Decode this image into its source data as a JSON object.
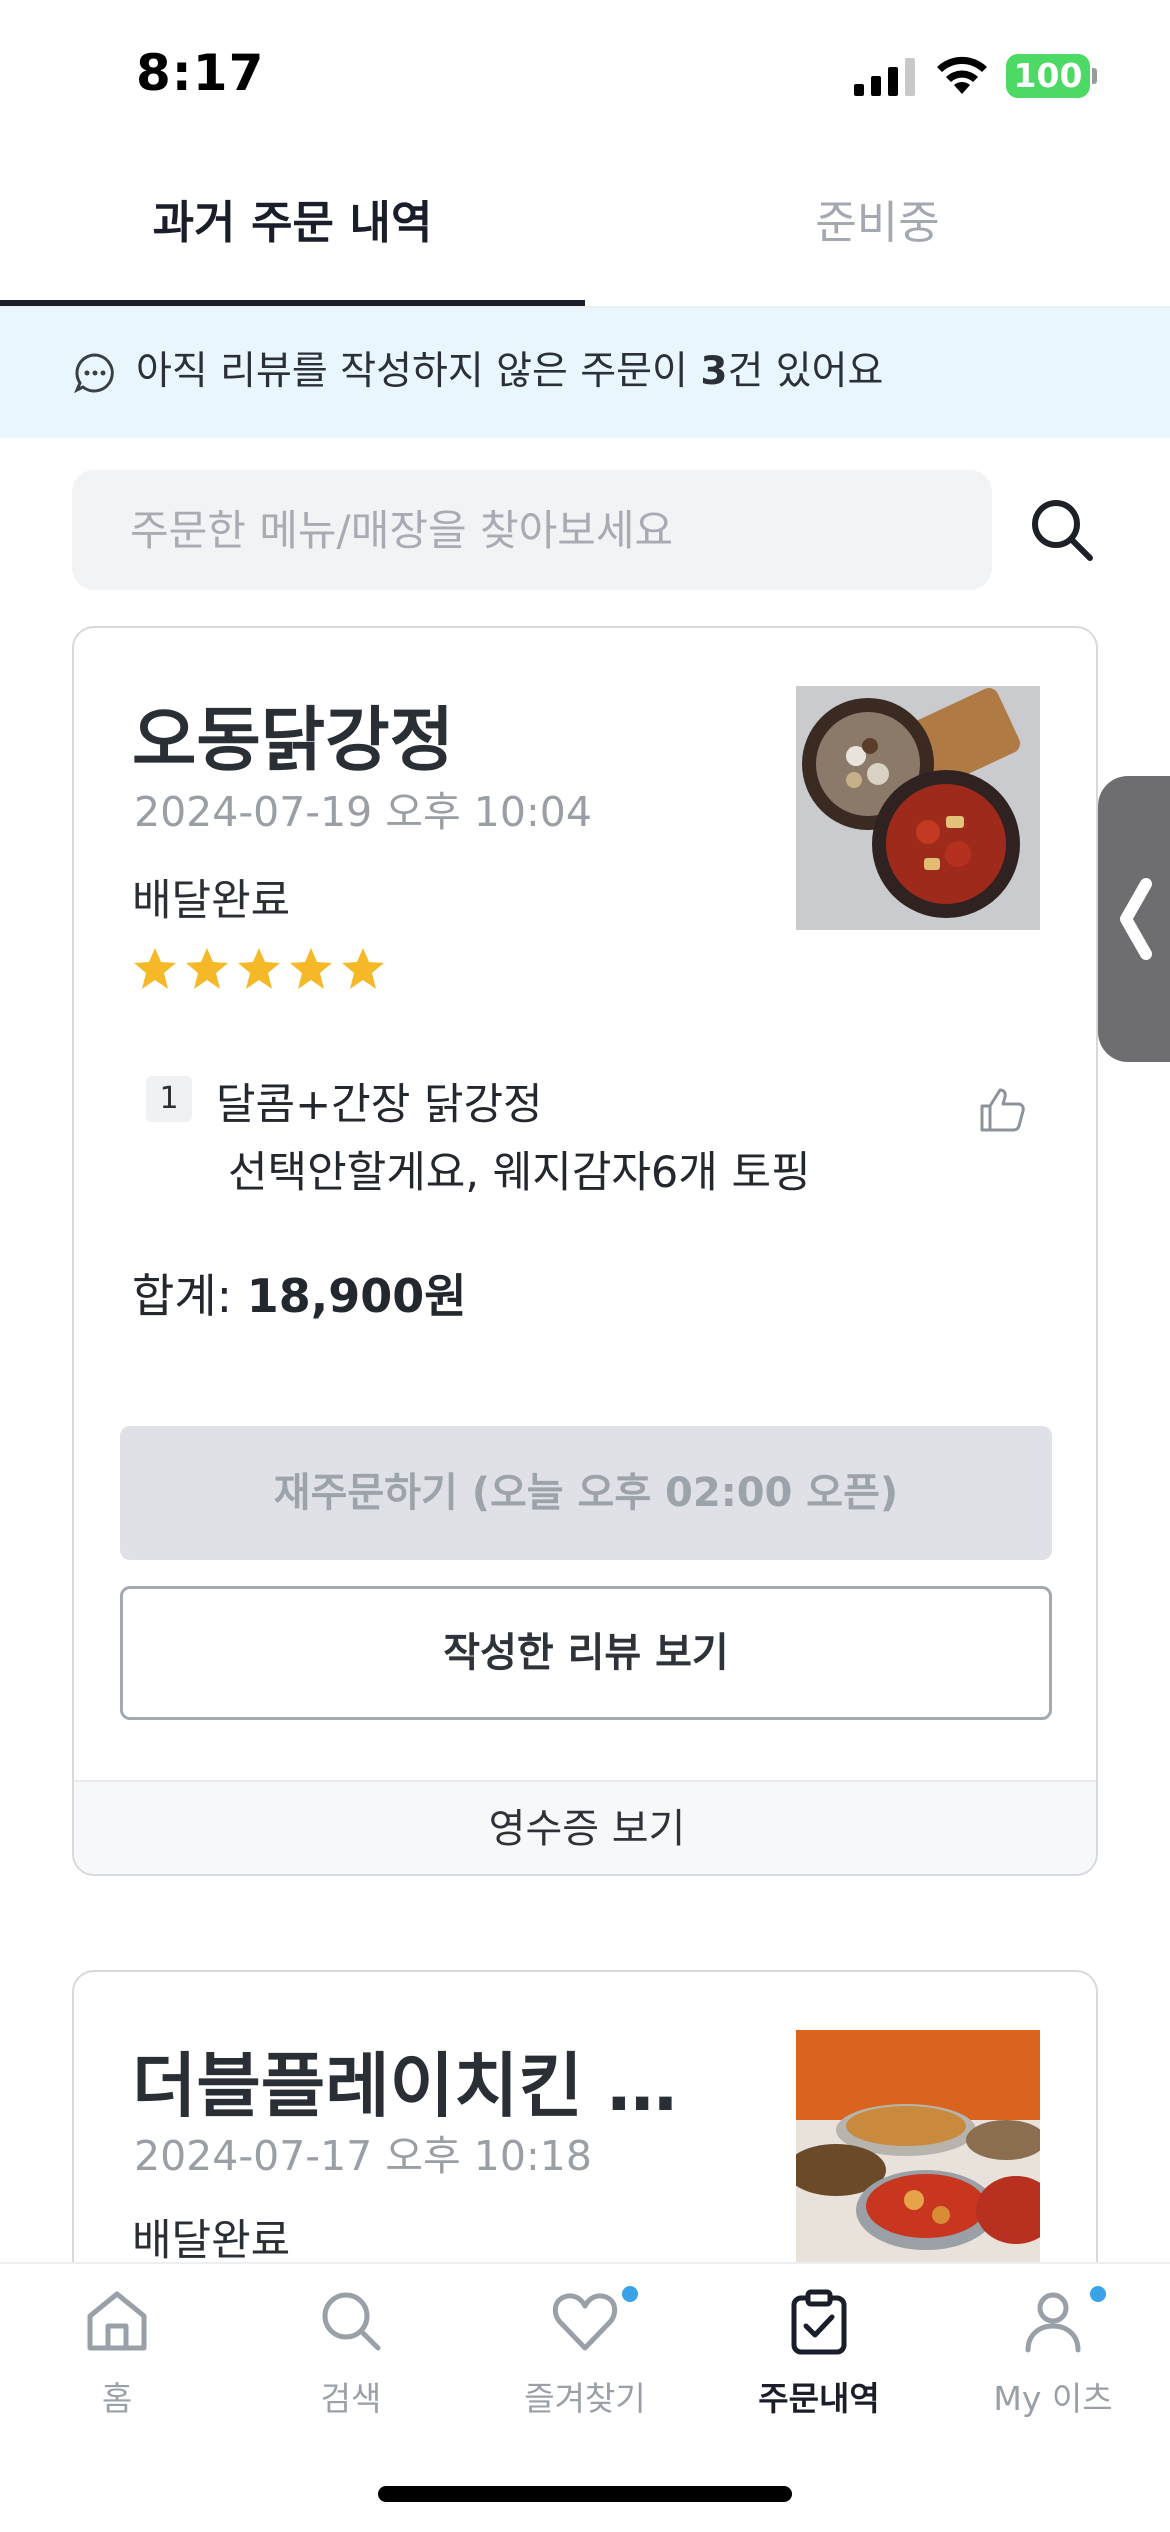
{
  "status_bar": {
    "time": "8:17",
    "battery": "100"
  },
  "tabs": [
    {
      "label": "과거 주문 내역",
      "active": true
    },
    {
      "label": "준비중",
      "active": false
    }
  ],
  "banner": {
    "text_before": "아직 리뷰를 작성하지 않은 주문이 ",
    "count": "3",
    "text_after": "건 있어요"
  },
  "search": {
    "placeholder": "주문한 메뉴/매장을 찾아보세요",
    "value": ""
  },
  "orders": [
    {
      "store": "오동닭강정",
      "date": "2024-07-19 오후 10:04",
      "status": "배달완료",
      "rating": 5,
      "items": [
        {
          "qty": "1",
          "name": "달콤+간장 닭강정",
          "options": "선택안할게요, 웨지감자6개 토핑"
        }
      ],
      "total_label": "합계: ",
      "total_value": "18,900원",
      "reorder_label": "재주문하기 (오늘 오후 02:00 오픈)",
      "review_label": "작성한 리뷰 보기",
      "receipt_label": "영수증 보기"
    },
    {
      "store": "더블플레이치킨 홍대점",
      "date": "2024-07-17 오후 10:18",
      "status": "배달완료"
    }
  ],
  "bottom_nav": [
    {
      "label": "홈",
      "icon": "home-icon"
    },
    {
      "label": "검색",
      "icon": "search-icon"
    },
    {
      "label": "즐겨찾기",
      "icon": "heart-icon",
      "dot": true
    },
    {
      "label": "주문내역",
      "icon": "clipboard-check-icon",
      "active": true
    },
    {
      "label": "My 이츠",
      "icon": "person-icon",
      "dot": true
    }
  ],
  "colors": {
    "accent": "#1a1d2a",
    "star": "#f5b928",
    "banner_bg": "#e9f6fd",
    "dot": "#3aa3e8"
  }
}
